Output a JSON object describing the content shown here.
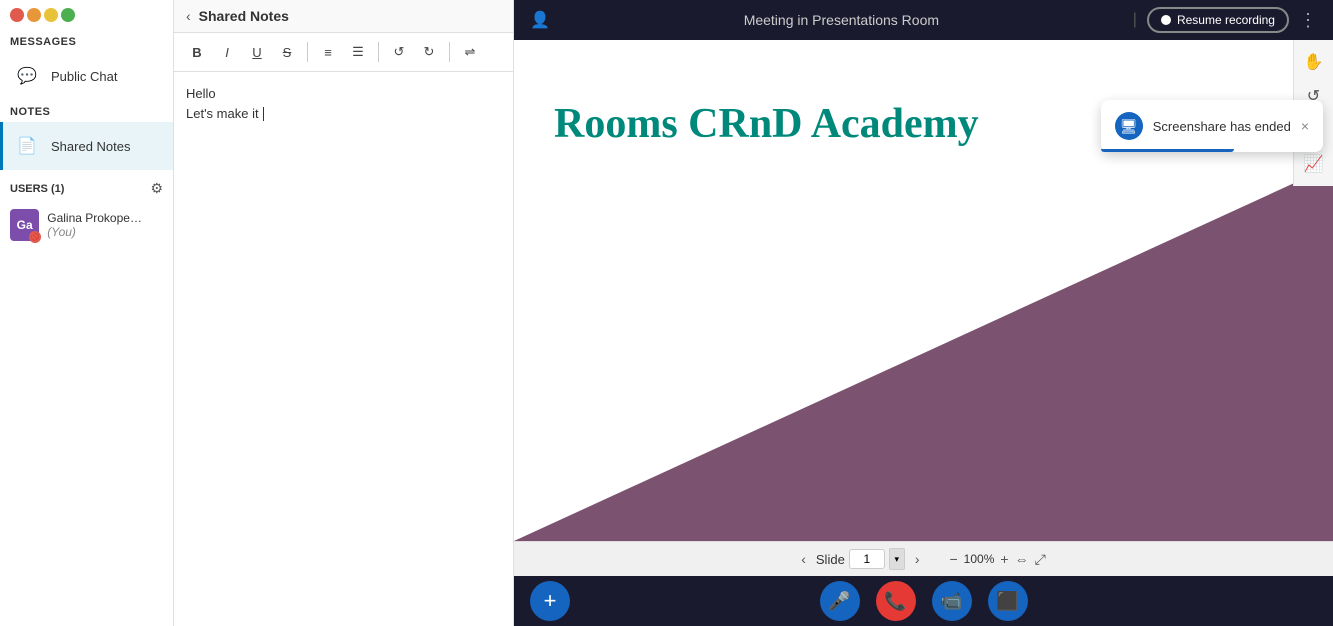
{
  "sidebar": {
    "messages_label": "MESSAGES",
    "notes_label": "NOTES",
    "public_chat_label": "Public Chat",
    "shared_notes_label": "Shared Notes",
    "users_label": "USERS (1)",
    "user": {
      "name": "Galina Prokope…",
      "you_label": "(You)",
      "initials": "Ga"
    }
  },
  "notes_panel": {
    "back_label": "‹",
    "title": "Shared Notes",
    "toolbar": {
      "bold": "B",
      "italic": "I",
      "underline": "U",
      "strikethrough": "S",
      "ordered_list": "≡",
      "unordered_list": "☰",
      "undo": "↺",
      "redo": "↻",
      "exchange": "⇌"
    },
    "content_line1": "Hello",
    "content_line2": "Let's make it"
  },
  "header": {
    "title": "Meeting in Presentations Room",
    "resume_btn": "Resume recording"
  },
  "slide": {
    "title": "Rooms CRnD Academy",
    "slide_label": "Slide",
    "slide_number": "1",
    "zoom_level": "100%"
  },
  "notification": {
    "text": "Screenshare has ended",
    "close": "×"
  },
  "bottom_bar": {
    "add": "+",
    "mic": "🎤",
    "phone": "📞",
    "video": "📹",
    "screen": "⬛"
  }
}
